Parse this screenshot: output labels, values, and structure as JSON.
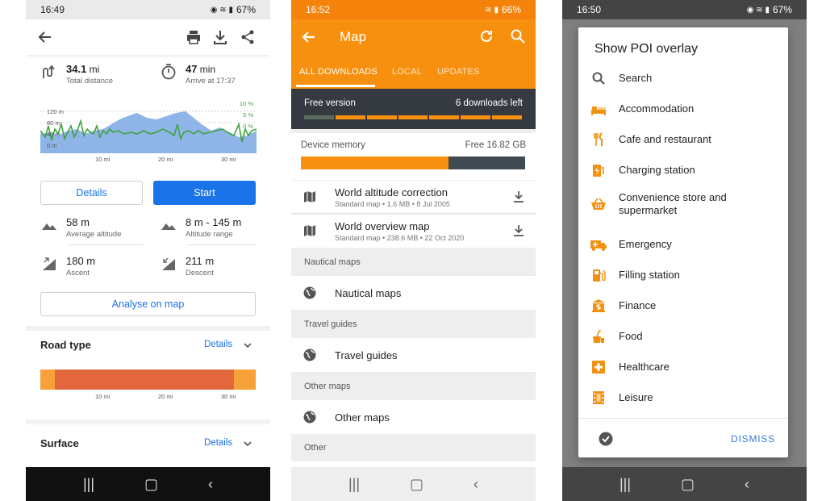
{
  "phone1": {
    "status": {
      "time": "16:49",
      "battery": "67%"
    },
    "distance": {
      "value": "34.1",
      "unit": " mi",
      "label": "Total distance"
    },
    "duration": {
      "value": "47",
      "unit": " min",
      "label": "Arrive at 17:37"
    },
    "chart": {
      "y_labels": [
        "120 m",
        "80 m",
        "40 m",
        "0 m"
      ],
      "grade_labels": [
        "10 %",
        "5 %",
        "0 %"
      ],
      "x_labels": [
        "10 mi",
        "20 mi",
        "30 mi"
      ]
    },
    "details_button": "Details",
    "start_button": "Start",
    "avg_altitude": {
      "value": "58 m",
      "label": "Average altitude"
    },
    "alt_range": {
      "value": "8 m - 145 m",
      "label": "Altitude range"
    },
    "ascent": {
      "value": "180 m",
      "label": "Ascent"
    },
    "descent": {
      "value": "211 m",
      "label": "Descent"
    },
    "analyse_button": "Analyse on map",
    "road_type": {
      "title": "Road type",
      "link": "Details"
    },
    "road_ticks": [
      "10 mi",
      "20 mi",
      "30 mi"
    ],
    "surface": {
      "title": "Surface",
      "link": "Details"
    }
  },
  "phone2": {
    "status": {
      "time": "16:52",
      "battery": "66%"
    },
    "title": "Map",
    "tabs": [
      "ALL DOWNLOADS",
      "LOCAL",
      "UPDATES"
    ],
    "free_version": "Free version",
    "downloads_left": "6 downloads left",
    "device_memory": "Device memory",
    "memory_free": "Free 16.82 GB",
    "memory_used_fraction": 0.66,
    "items": [
      {
        "title": "World altitude correction",
        "sub": "Standard map • 1.6 MB • 8 Jul 2005"
      },
      {
        "title": "World overview map",
        "sub": "Standard map • 238.6 MB • 22 Oct 2020"
      }
    ],
    "sections": [
      {
        "header": "Nautical maps",
        "item": "Nautical maps"
      },
      {
        "header": "Travel guides",
        "item": "Travel guides"
      },
      {
        "header": "Other maps",
        "item": "Other maps"
      },
      {
        "header": "Other",
        "item": ""
      }
    ]
  },
  "phone3": {
    "status": {
      "time": "16:50",
      "battery": "67%"
    },
    "dialog_title": "Show POI overlay",
    "items": [
      {
        "label": "Search",
        "icon": "search-icon"
      },
      {
        "label": "Accommodation",
        "icon": "bed-icon"
      },
      {
        "label": "Cafe and restaurant",
        "icon": "fork-knife-icon"
      },
      {
        "label": "Charging station",
        "icon": "charging-icon"
      },
      {
        "label": "Convenience store and supermarket",
        "icon": "basket-icon"
      },
      {
        "label": "Emergency",
        "icon": "ambulance-icon"
      },
      {
        "label": "Filling station",
        "icon": "fuel-icon"
      },
      {
        "label": "Finance",
        "icon": "finance-icon"
      },
      {
        "label": "Food",
        "icon": "food-icon"
      },
      {
        "label": "Healthcare",
        "icon": "healthcare-icon"
      },
      {
        "label": "Leisure",
        "icon": "film-icon"
      }
    ],
    "dismiss": "DISMISS"
  },
  "colors": {
    "accent_orange": "#f7900e",
    "link_blue": "#1a73e8",
    "poi_orange": "#f29111"
  }
}
